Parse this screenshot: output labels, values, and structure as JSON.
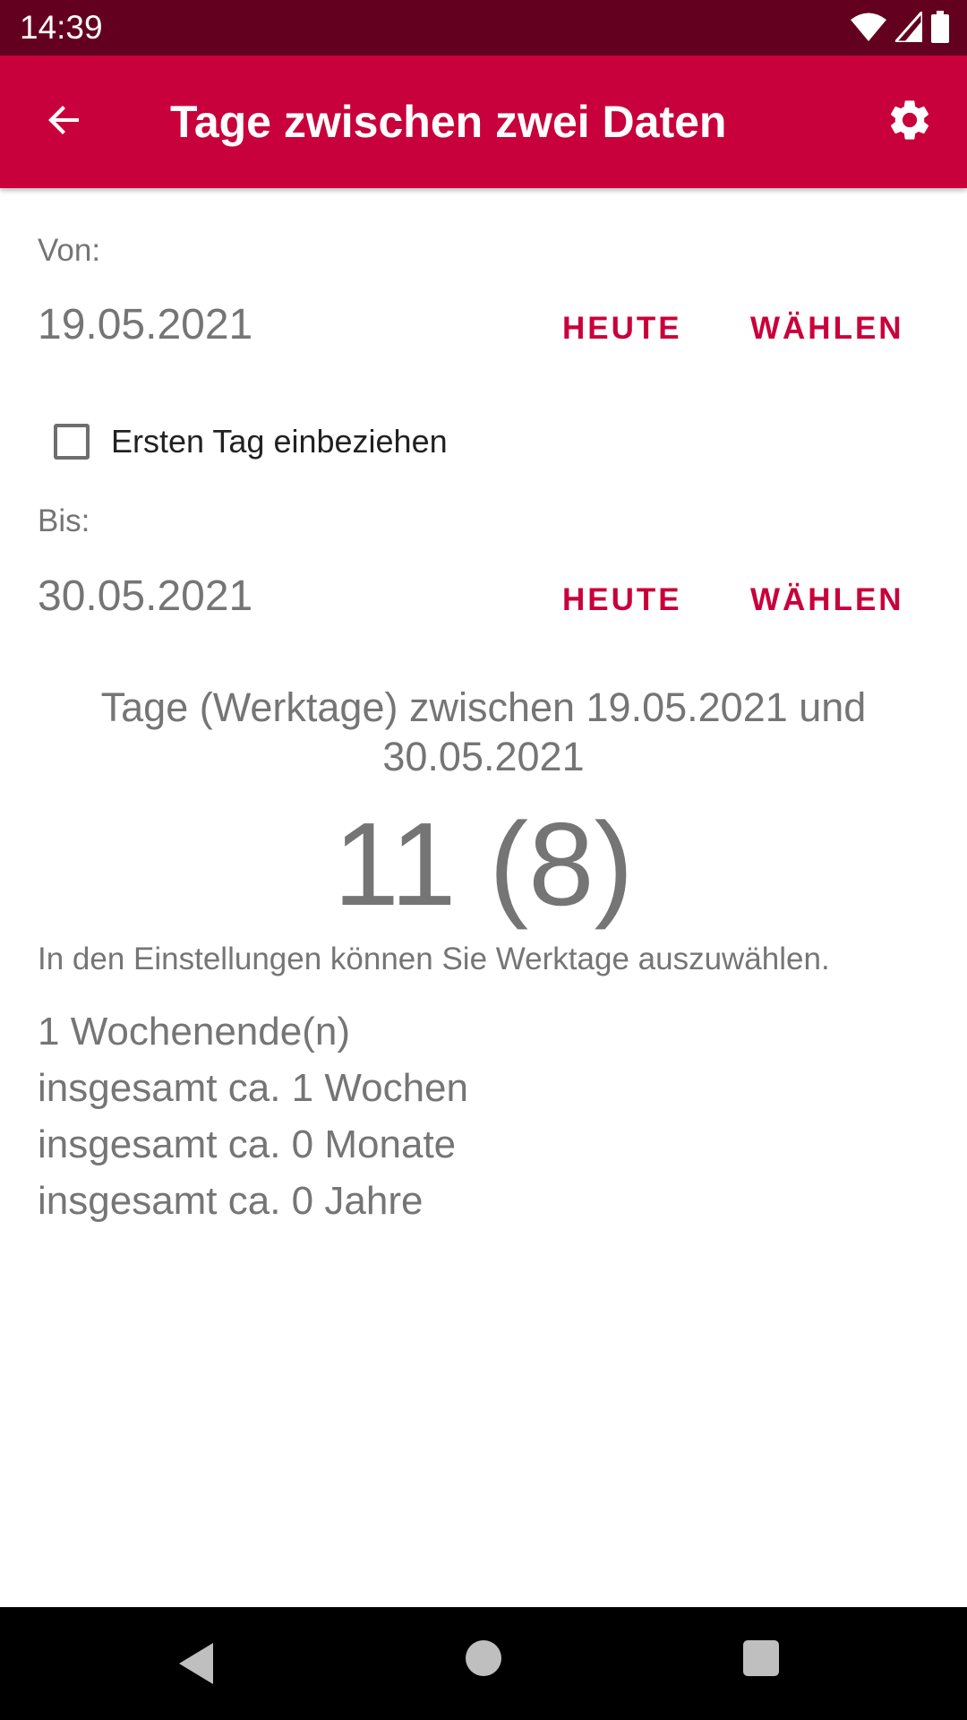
{
  "status_bar": {
    "time": "14:39",
    "icons": [
      "wifi-icon",
      "signal-icon",
      "battery-icon"
    ]
  },
  "app_bar": {
    "title": "Tage zwischen zwei Daten",
    "back_icon": "arrow-back-icon",
    "settings_icon": "gear-icon"
  },
  "from": {
    "label": "Von:",
    "date": "19.05.2021",
    "today_button": "HEUTE",
    "choose_button": "WÄHLEN"
  },
  "include_first_day": {
    "label": "Ersten Tag einbeziehen",
    "checked": false
  },
  "to": {
    "label": "Bis:",
    "date": "30.05.2021",
    "today_button": "HEUTE",
    "choose_button": "WÄHLEN"
  },
  "result": {
    "header": "Tage (Werktage) zwischen 19.05.2021 und 30.05.2021",
    "number": "11 (8)",
    "hint": "In den Einstellungen können Sie Werktage auszuwählen.",
    "stats": [
      "1 Wochenende(n)",
      "insgesamt ca. 1 Wochen",
      "insgesamt ca. 0 Monate",
      "insgesamt ca. 0 Jahre"
    ]
  },
  "colors": {
    "primary": "#c8003b",
    "status_bar": "#64001f",
    "text_secondary": "#757575"
  },
  "nav_bar": {
    "icons": [
      "nav-back-icon",
      "nav-home-icon",
      "nav-recents-icon"
    ]
  }
}
